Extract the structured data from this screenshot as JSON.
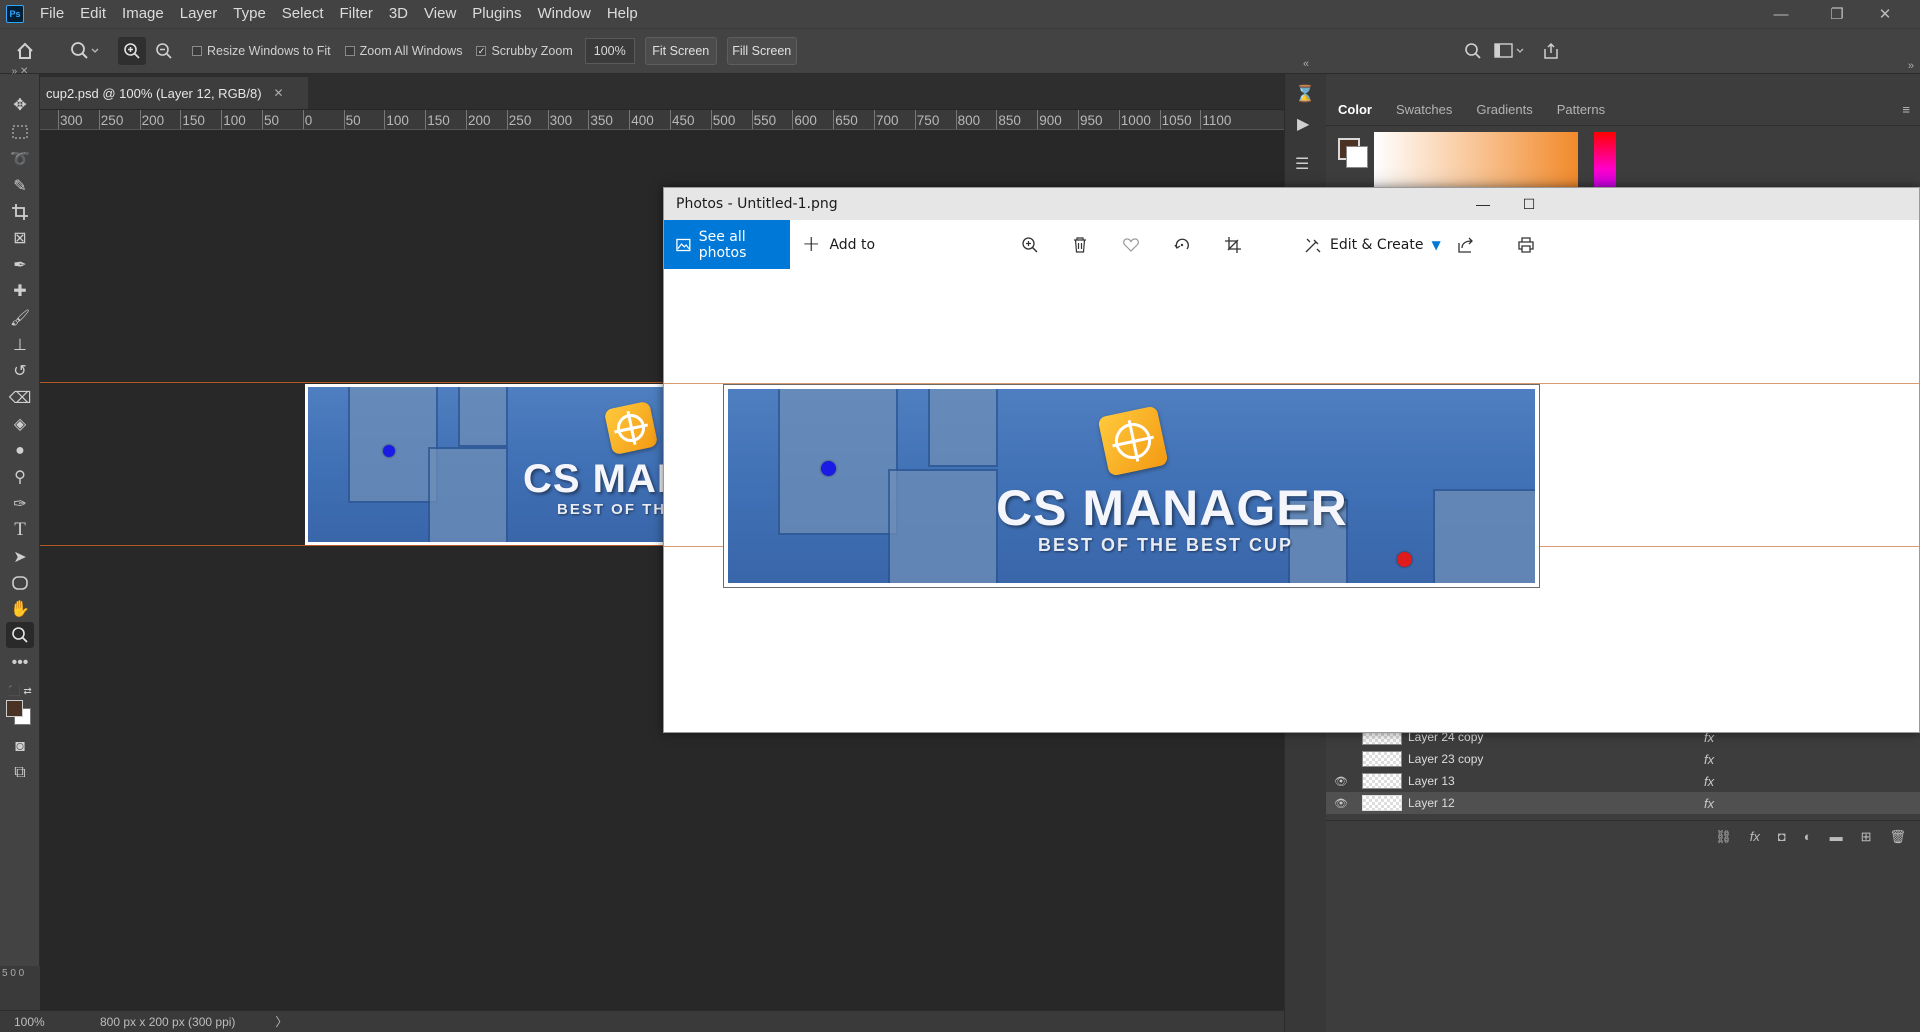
{
  "photoshop": {
    "menu": [
      "File",
      "Edit",
      "Image",
      "Layer",
      "Type",
      "Select",
      "Filter",
      "3D",
      "View",
      "Plugins",
      "Window",
      "Help"
    ],
    "logo_text": "Ps",
    "options": {
      "resize_windows": "Resize Windows to Fit",
      "resize_windows_checked": false,
      "zoom_all": "Zoom All Windows",
      "zoom_all_checked": false,
      "scrubby_zoom": "Scrubby Zoom",
      "scrubby_zoom_checked": true,
      "zoom_value": "100%",
      "fit_screen": "Fit Screen",
      "fill_screen": "Fill Screen"
    },
    "document_tab": {
      "title": "cup2.psd @ 100% (Layer 12, RGB/8)",
      "close": "✕"
    },
    "ruler_labels": [
      "300",
      "250",
      "200",
      "150",
      "100",
      "50",
      "0",
      "50",
      "100",
      "150",
      "200",
      "250",
      "300",
      "350",
      "400",
      "450",
      "500",
      "550",
      "600",
      "650",
      "700",
      "750",
      "800",
      "850",
      "900",
      "950",
      "1000",
      "1050",
      "1100"
    ],
    "status": {
      "zoom": "100%",
      "doc_size": "800 px x 200 px (300 ppi)",
      "arrow": "〉"
    },
    "side_ruler_digits": "5 0 0",
    "panels": {
      "tabs": [
        "Color",
        "Swatches",
        "Gradients",
        "Patterns"
      ],
      "active_tab": "Color",
      "foreground_color": "#4a3325",
      "background_color": "#ffffff",
      "layers": [
        {
          "name": "Layer 24 copy",
          "visible": false,
          "fx": "fx"
        },
        {
          "name": "Layer 23 copy",
          "visible": false,
          "fx": "fx"
        },
        {
          "name": "Layer 13",
          "visible": true,
          "fx": "fx"
        },
        {
          "name": "Layer 12",
          "visible": true,
          "fx": "fx",
          "selected": true
        }
      ]
    }
  },
  "banner": {
    "title": "CS MANAGER",
    "subtitle": "BEST OF THE BEST CUP",
    "title_cropped": "CS MANA",
    "subtitle_cropped": "BEST OF THE B",
    "blue_dot_color": "#1a1ae6",
    "red_dot_color": "#e01b1b"
  },
  "photos": {
    "window_title": "Photos - Untitled-1.png",
    "see_all_photos": "See all photos",
    "add_to": "Add to",
    "edit_create": "Edit & Create",
    "accent_color": "#0078d7",
    "toolbar_icons": [
      "zoom-in-icon",
      "delete-icon",
      "favorite-icon",
      "rotate-icon",
      "crop-icon",
      "share-icon",
      "print-icon"
    ]
  }
}
